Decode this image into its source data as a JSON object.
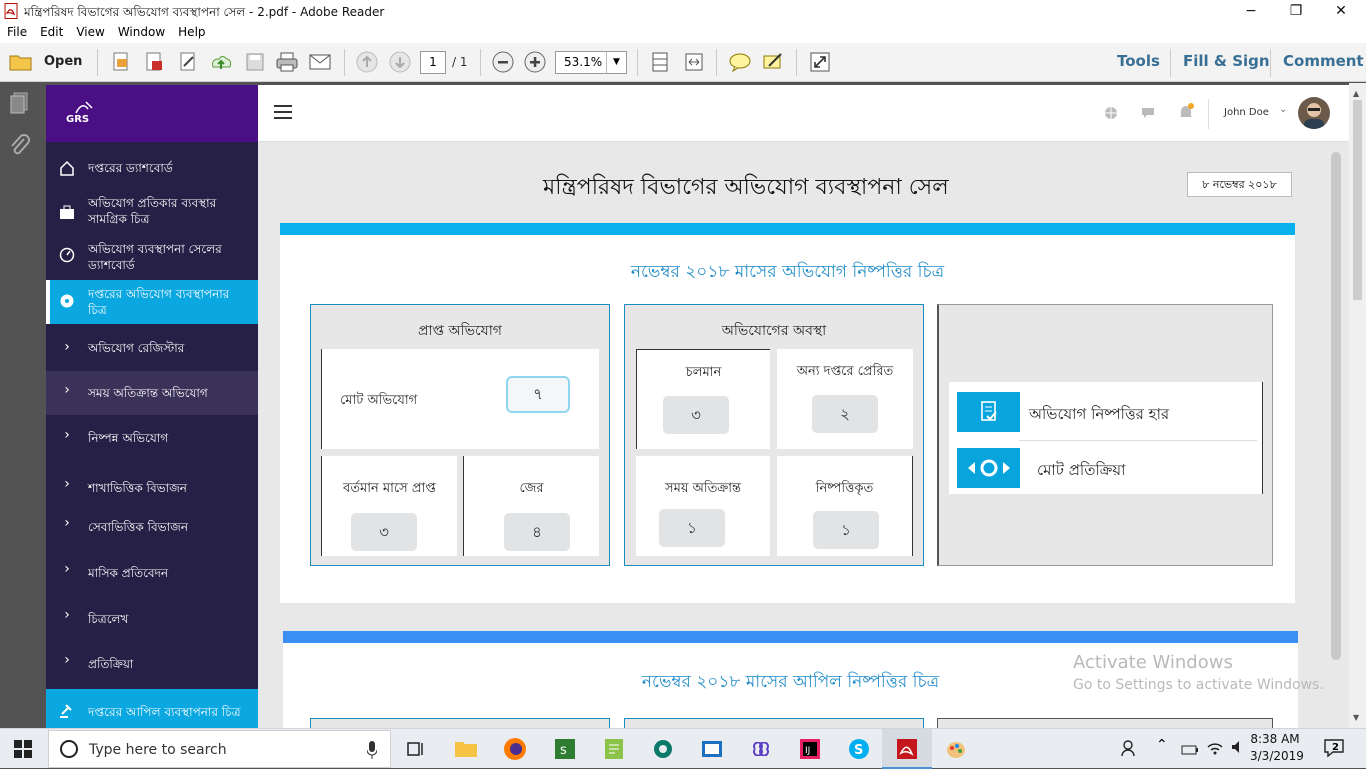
{
  "window": {
    "title": "মন্ত্রিপরিষদ বিভাগের অভিযোগ ব্যবস্থাপনা সেল - 2.pdf - Adobe Reader",
    "controls": {
      "minimize": "−",
      "restore": "❐",
      "close": "✕"
    }
  },
  "menu": [
    "File",
    "Edit",
    "View",
    "Window",
    "Help"
  ],
  "toolbar": {
    "open_label": "Open",
    "page_current": "1",
    "page_total": "/ 1",
    "zoom": "53.1%",
    "tools_label": "Tools",
    "fill_sign_label": "Fill & Sign",
    "comment_label": "Comment"
  },
  "app": {
    "brand": "GRS",
    "user_name": "John Doe",
    "page_title": "মন্ত্রিপরিষদ বিভাগের অভিযোগ ব্যবস্থাপনা সেল",
    "date": "৮ নভেম্বর ২০১৮"
  },
  "sidebar": {
    "items": [
      {
        "label": "দপ্তরের ড্যাশবোর্ড",
        "icon": "home-icon"
      },
      {
        "label": "অভিযোগ প্রতিকার ব্যবস্থার সামগ্রিক চিত্র",
        "icon": "bag-icon"
      },
      {
        "label": "অভিযোগ ব্যবস্থাপনা সেলের ড্যাশবোর্ড",
        "icon": "gauge-icon"
      },
      {
        "label": "দপ্তরের অভিযোগ ব্যবস্থাপনার চিত্র",
        "icon": "dashboard-icon",
        "active": true
      },
      {
        "label": "অভিযোগ রেজিস্টার",
        "icon": "chevron-right-icon"
      },
      {
        "label": "সময় অতিক্রান্ত অভিযোগ",
        "icon": "chevron-right-icon"
      },
      {
        "label": "নিষ্পন্ন অভিযোগ",
        "icon": "chevron-right-icon"
      },
      {
        "label": "শাখাভিত্তিক বিভাজন",
        "icon": "chevron-right-icon"
      },
      {
        "label": "সেবাভিত্তিক বিভাজন",
        "icon": "chevron-right-icon"
      },
      {
        "label": "মাসিক প্রতিবেদন",
        "icon": "chevron-right-icon"
      },
      {
        "label": "চিত্রলেখ",
        "icon": "chevron-right-icon"
      },
      {
        "label": "প্রতিক্রিয়া",
        "icon": "chevron-right-icon"
      },
      {
        "label": "দপ্তরের আপিল ব্যবস্থাপনার চিত্র",
        "icon": "gavel-icon"
      }
    ],
    "accent": "#0aa7e0"
  },
  "card1": {
    "title": "নভেম্বর ২০১৮ মাসের অভিযোগ নিষ্পত্তির চিত্র",
    "received": {
      "title": "প্রাপ্ত অভিযোগ",
      "total_label": "মোট অভিযোগ",
      "total_value": "৭",
      "current_label": "বর্তমান মাসে প্রাপ্ত",
      "current_value": "৩",
      "carry_label": "জের",
      "carry_value": "৪"
    },
    "status": {
      "title": "অভিযোগের অবস্থা",
      "running_label": "চলমান",
      "running_value": "৩",
      "forwarded_label": "অন্য দপ্তরে প্রেরিত",
      "forwarded_value": "২",
      "overdue_label": "সময় অতিক্রান্ত",
      "overdue_value": "১",
      "resolved_label": "নিষ্পত্তিকৃত",
      "resolved_value": "১"
    },
    "features": {
      "rate_label": "অভিযোগ নিষ্পত্তির হার",
      "feedback_label": "মোট প্রতিক্রিয়া"
    }
  },
  "card2": {
    "title": "নভেম্বর ২০১৮ মাসের আপিল নিষ্পত্তির চিত্র"
  },
  "watermark": {
    "line1": "Activate Windows",
    "line2": "Go to Settings to activate Windows."
  },
  "taskbar": {
    "search_placeholder": "Type here to search",
    "time": "8:38 AM",
    "date": "3/3/2019",
    "notification_count": "2"
  }
}
